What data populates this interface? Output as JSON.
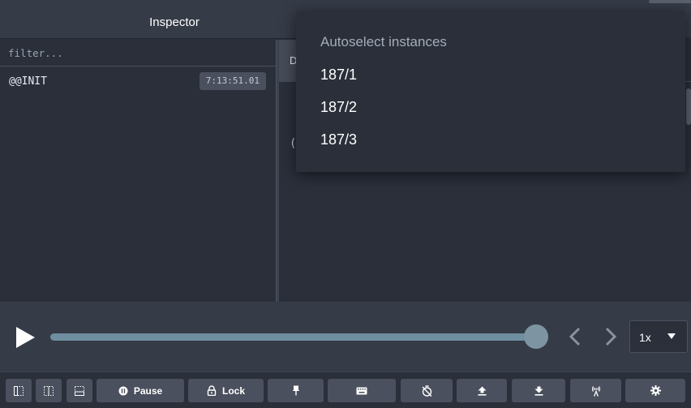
{
  "header": {
    "title": "Inspector"
  },
  "action_list": {
    "filter_placeholder": "filter...",
    "items": [
      {
        "name": "@@INIT",
        "time": "7:13:51.01"
      }
    ]
  },
  "right_pane": {
    "tab_initial": "D",
    "content_initial": "("
  },
  "dropdown": {
    "heading": "Autoselect instances",
    "items": [
      "187/1",
      "187/2",
      "187/3"
    ]
  },
  "slider": {
    "position": 1.0,
    "speed": "1x"
  },
  "toolbar": {
    "pause_label": "Pause",
    "lock_label": "Lock",
    "icons": [
      "layout-left-icon",
      "layout-bottom-icon",
      "layout-right-icon",
      "pause-icon",
      "lock-icon",
      "pin-icon",
      "keyboard-icon",
      "timer-off-icon",
      "upload-icon",
      "download-icon",
      "remote-icon",
      "gear-icon"
    ]
  },
  "colors": {
    "background": "#2a2f3a",
    "header": "#353b47",
    "button": "#4a505d",
    "slider_track": "#6f8ea0",
    "slider_thumb": "#7d95a3",
    "muted_text": "#a4adb8"
  }
}
